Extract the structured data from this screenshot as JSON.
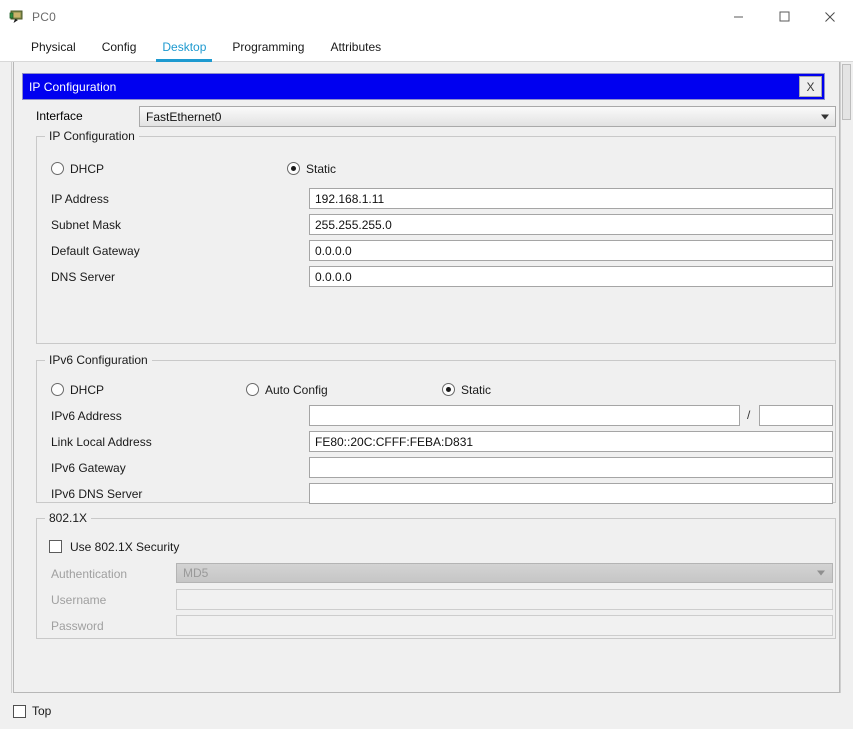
{
  "window": {
    "title": "PC0",
    "icon": "pc-device-icon",
    "controls": {
      "minimize": "minimize-icon",
      "maximize": "maximize-icon",
      "close": "close-icon"
    }
  },
  "tabs": [
    {
      "label": "Physical",
      "active": false
    },
    {
      "label": "Config",
      "active": false
    },
    {
      "label": "Desktop",
      "active": true
    },
    {
      "label": "Programming",
      "active": false
    },
    {
      "label": "Attributes",
      "active": false
    }
  ],
  "dialog": {
    "title": "IP Configuration",
    "close_label": "X",
    "accent_color": "#0000f0",
    "tab_accent_color": "#1e9ad0"
  },
  "interface": {
    "label": "Interface",
    "value": "FastEthernet0",
    "arrow": "chevron-down-icon"
  },
  "ipv4": {
    "legend": "IP Configuration",
    "modes": [
      {
        "label": "DHCP",
        "selected": false
      },
      {
        "label": "Static",
        "selected": true
      }
    ],
    "fields": [
      {
        "label": "IP Address",
        "value": "192.168.1.11",
        "placeholder": ""
      },
      {
        "label": "Subnet Mask",
        "value": "255.255.255.0",
        "placeholder": ""
      },
      {
        "label": "Default Gateway",
        "value": "0.0.0.0",
        "placeholder": ""
      },
      {
        "label": "DNS Server",
        "value": "0.0.0.0",
        "placeholder": ""
      }
    ]
  },
  "ipv6": {
    "legend": "IPv6 Configuration",
    "modes": [
      {
        "label": "DHCP",
        "selected": false
      },
      {
        "label": "Auto Config",
        "selected": false
      },
      {
        "label": "Static",
        "selected": true
      }
    ],
    "prefix_separator": "/",
    "fields": [
      {
        "label": "IPv6 Address",
        "value": "",
        "placeholder": ""
      },
      {
        "label": "Link Local Address",
        "value": "FE80::20C:CFFF:FEBA:D831",
        "placeholder": ""
      },
      {
        "label": "IPv6 Gateway",
        "value": "",
        "placeholder": ""
      },
      {
        "label": "IPv6 DNS Server",
        "value": "",
        "placeholder": ""
      }
    ],
    "prefix_length": ""
  },
  "dot1x": {
    "legend": "802.1X",
    "use_security": {
      "label": "Use 802.1X Security",
      "checked": false
    },
    "authentication": {
      "label": "Authentication",
      "value": "MD5",
      "enabled": false
    },
    "username": {
      "label": "Username",
      "value": "",
      "enabled": false
    },
    "password": {
      "label": "Password",
      "value": "",
      "enabled": false
    }
  },
  "bottom": {
    "top_checkbox": {
      "label": "Top",
      "checked": false
    }
  }
}
